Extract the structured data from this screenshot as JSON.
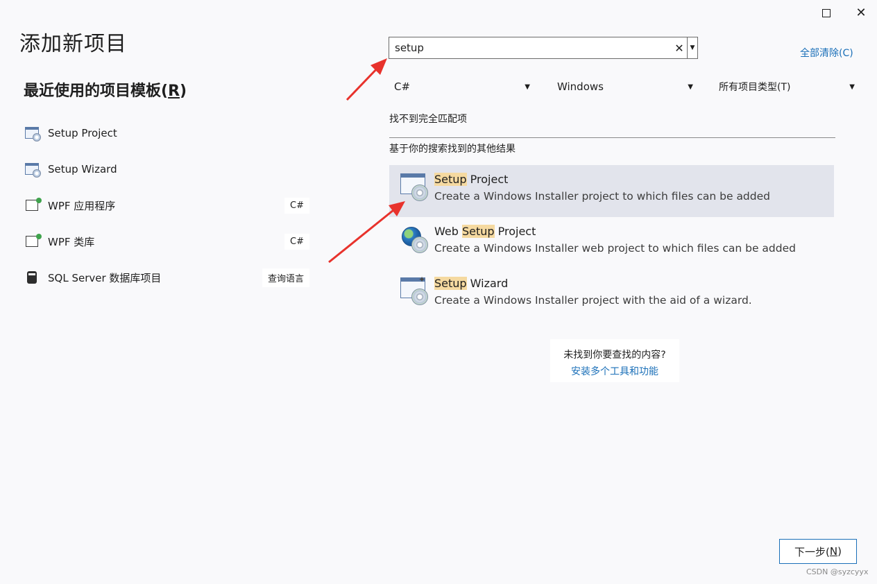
{
  "window": {
    "title": "添加新项目",
    "maximize_icon": "maximize-icon",
    "close_icon": "close-icon"
  },
  "recent": {
    "title_prefix": "最近使用的项目模板(",
    "title_key": "R",
    "title_suffix": ")",
    "items": [
      {
        "label": "Setup Project",
        "icon": "setup-project-icon",
        "tag": ""
      },
      {
        "label": "Setup Wizard",
        "icon": "setup-wizard-icon",
        "tag": ""
      },
      {
        "label": "WPF 应用程序",
        "icon": "wpf-app-icon",
        "tag": "C#"
      },
      {
        "label": "WPF 类库",
        "icon": "wpf-library-icon",
        "tag": "C#"
      },
      {
        "label": "SQL Server 数据库项目",
        "icon": "database-icon",
        "tag": "查询语言"
      }
    ]
  },
  "search": {
    "value": "setup",
    "clear_symbol": "✕",
    "clear_all_label": "全部清除(C)"
  },
  "filters": {
    "language": "C#",
    "platform": "Windows",
    "project_type": "所有项目类型(T)"
  },
  "results": {
    "no_match": "找不到完全匹配项",
    "other_header": "基于你的搜索找到的其他结果",
    "items": [
      {
        "name_before": "",
        "name_highlight": "Setup",
        "name_after": " Project",
        "desc": "Create a Windows Installer project to which files can be added",
        "selected": true
      },
      {
        "name_before": "Web ",
        "name_highlight": "Setup",
        "name_after": " Project",
        "desc": "Create a Windows Installer web project to which files can be added",
        "selected": false
      },
      {
        "name_before": "",
        "name_highlight": "Setup",
        "name_after": " Wizard",
        "desc": "Create a Windows Installer project with the aid of a wizard.",
        "selected": false
      }
    ]
  },
  "help": {
    "question": "未找到你要查找的内容?",
    "link": "安装多个工具和功能"
  },
  "footer": {
    "next_prefix": "下一步(",
    "next_key": "N",
    "next_suffix": ")",
    "watermark": "CSDN @syzcyyx"
  },
  "colors": {
    "link": "#1a6fb8",
    "highlight": "#f5d9a0",
    "selected_row": "#e2e4ec",
    "annotation_arrow": "#e8322c"
  }
}
